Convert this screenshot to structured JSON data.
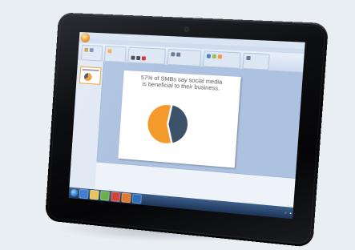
{
  "app": {
    "window_title": "",
    "tabs": [
      "",
      "",
      "",
      "",
      "",
      "",
      ""
    ]
  },
  "slide": {
    "title_line1": "57% of SMBs say social media",
    "title_line2": "is beneficial to their business.",
    "label_left": "",
    "label_right_top": "",
    "label_right_bottom": "",
    "label_bottom_left": "",
    "logo": ""
  },
  "chart_data": {
    "type": "pie",
    "values": [
      43,
      57
    ],
    "colors": [
      "#3d5268",
      "#f39a2a"
    ],
    "title": ""
  },
  "taskbar": {
    "tray_text": ""
  },
  "colors": {
    "accent": "#f39a2a",
    "dark_slice": "#3d5268",
    "taskbar": "#1c3457"
  }
}
